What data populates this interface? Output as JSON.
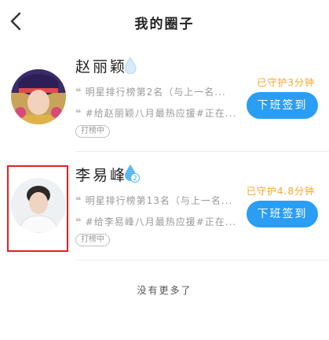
{
  "header": {
    "title": "我的圈子"
  },
  "circles": [
    {
      "name": "赵丽颖",
      "line1": "明星排行榜第2名（与上一名...",
      "line2": "#给赵丽颖八月最热应援#正在...",
      "tag": "打榜中",
      "guard_text": "已守护3分钟",
      "action_label": "下班签到",
      "drop_badge": ""
    },
    {
      "name": "李易峰",
      "line1": "明星排行榜第13名（与上一名...",
      "line2": "#给李易峰八月最热应援#正在...",
      "tag": "打榜中",
      "guard_text": "已守护4.8分钟",
      "action_label": "下班签到",
      "drop_badge": "2"
    }
  ],
  "footer": {
    "no_more": "没有更多了"
  },
  "colors": {
    "accent": "#2a9df4",
    "guard": "#f5a623",
    "highlight": "#e02020"
  }
}
